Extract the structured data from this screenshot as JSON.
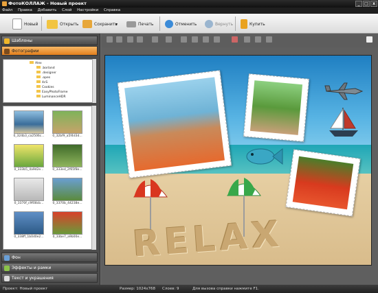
{
  "window": {
    "title": "ФотоКОЛЛАЖ - Новый проект"
  },
  "menu": [
    "Файл",
    "Правка",
    "Добавить",
    "Слой",
    "Настройки",
    "Справка"
  ],
  "toolbar": {
    "new_label": "Новый",
    "open_label": "Открыть",
    "save_label": "Сохранить",
    "print_label": "Печать",
    "undo_label": "Отменить",
    "redo_label": "Вернуть",
    "buy_label": "Купить"
  },
  "left": {
    "templates_label": "Шаблоны",
    "photos_label": "Фотографии",
    "background_label": "Фон",
    "effects_label": "Эффекты и рамки",
    "text_label": "Текст и украшения"
  },
  "tree": [
    "Alex",
    ".borland",
    ".designer",
    ".opes",
    "4cS",
    "Cookies",
    "EasyPhotoFrame",
    "LuminanceHDR"
  ],
  "thumbs": [
    {
      "caption": "0_324b3_ca2506c..."
    },
    {
      "caption": "0_32bf9_a5f4d3d..."
    },
    {
      "caption": "0_333b5_4a9d2e..."
    },
    {
      "caption": "0_333ed_2f65f8e..."
    },
    {
      "caption": "0_3370f_c9f08cb..."
    },
    {
      "caption": "0_3370b_44238e..."
    },
    {
      "caption": "0_338ff_1b0d0e2..."
    },
    {
      "caption": "0_33be7_a9b00e..."
    }
  ],
  "collage": {
    "sand_text": "RELAX"
  },
  "status": {
    "project": "Проект: Новый проект",
    "size": "Размер: 1024x768",
    "layers": "Слоев: 9",
    "help": "Для вызова справки нажмите F1."
  },
  "colors": {
    "accent": "#e8871f",
    "panel": "#4c4c4c",
    "toolbar": "#e6e6e6"
  }
}
